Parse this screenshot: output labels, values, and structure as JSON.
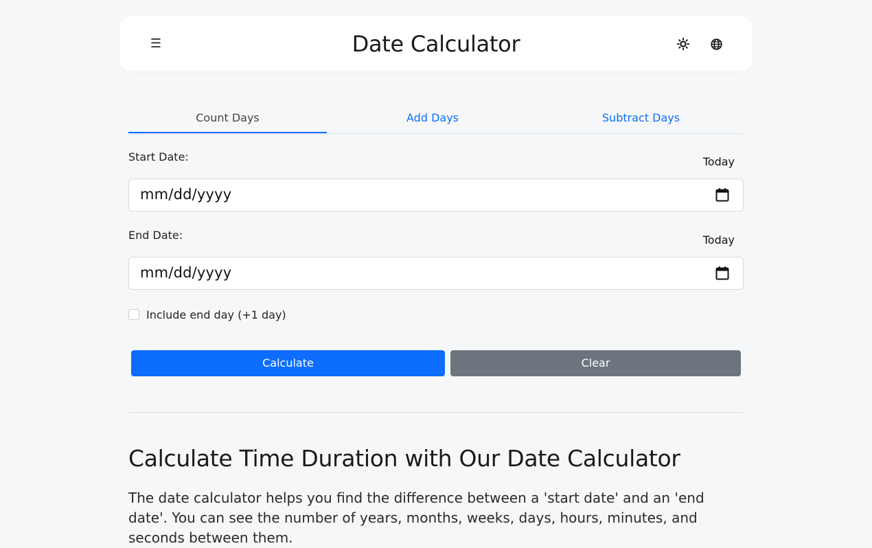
{
  "header": {
    "title": "Date Calculator",
    "menu_icon": "☰",
    "theme_icon": "sun-icon",
    "language_icon": "globe-icon"
  },
  "tabs": [
    {
      "label": "Count Days",
      "active": true
    },
    {
      "label": "Add Days",
      "active": false
    },
    {
      "label": "Subtract Days",
      "active": false
    }
  ],
  "form": {
    "start_label": "Start Date:",
    "end_label": "End Date:",
    "today_label": "Today",
    "start_value": "mm/dd/yyyy",
    "end_value": "mm/dd/yyyy",
    "include_end_label": "Include end day (+1 day)",
    "include_end_checked": false
  },
  "buttons": {
    "calculate": "Calculate",
    "clear": "Clear"
  },
  "info": {
    "heading": "Calculate Time Duration with Our Date Calculator",
    "text": "The date calculator helps you find the difference between a 'start date' and an 'end date'. You can see the number of years, months, weeks, days, hours, minutes, and seconds between them."
  },
  "colors": {
    "primary": "#0d6efd",
    "secondary": "#6c757d",
    "background": "#f6f7f8"
  }
}
